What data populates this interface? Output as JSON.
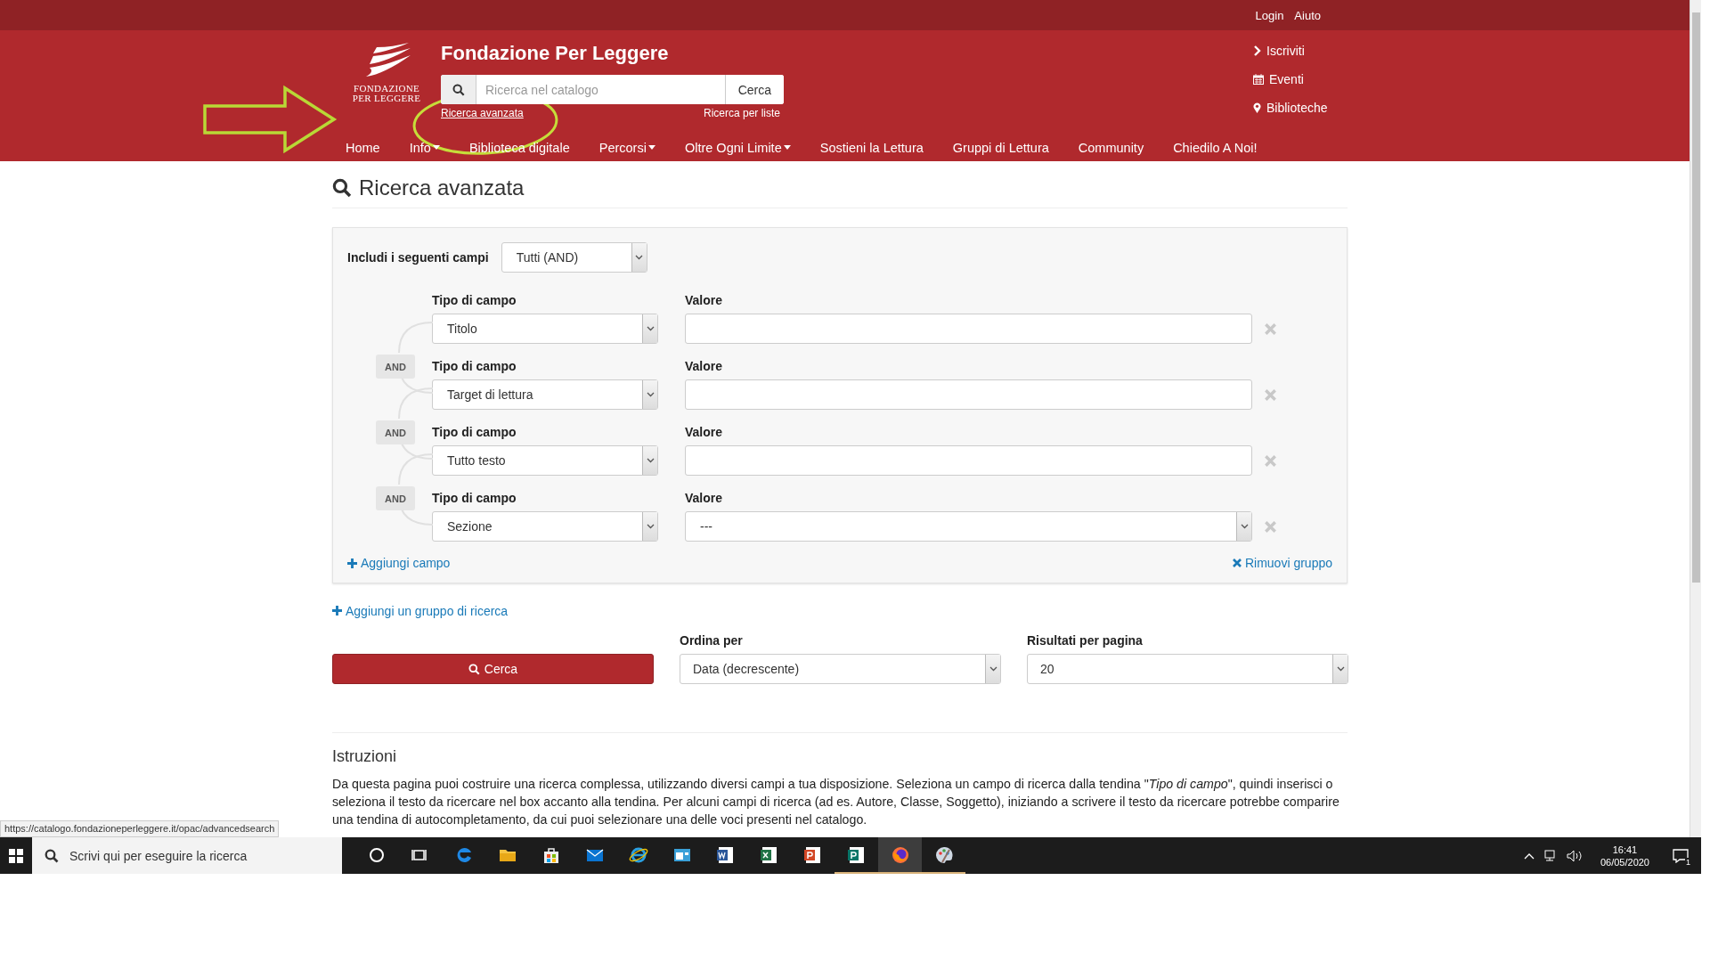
{
  "top_bar": {
    "links": [
      "Login",
      "Aiuto"
    ]
  },
  "header": {
    "logo_text": [
      "FONDAZIONE",
      "PER LEGGERE"
    ],
    "site_title": "Fondazione Per Leggere",
    "search": {
      "placeholder": "Ricerca nel catalogo",
      "button": "Cerca"
    },
    "search_links": [
      "Ricerca avanzata",
      "Ricerca per liste"
    ],
    "side_links": [
      {
        "label": "Iscriviti",
        "kind": "chevron"
      },
      {
        "label": "Eventi",
        "kind": "calendar"
      },
      {
        "label": "Biblioteche",
        "kind": "pin"
      }
    ],
    "nav": [
      {
        "label": "Home",
        "dropdown": false
      },
      {
        "label": "Info",
        "dropdown": true
      },
      {
        "label": "Biblioteca digitale",
        "dropdown": false
      },
      {
        "label": "Percorsi",
        "dropdown": true
      },
      {
        "label": "Oltre Ogni Limite",
        "dropdown": true
      },
      {
        "label": "Sostieni la Lettura",
        "dropdown": false
      },
      {
        "label": "Gruppi di Lettura",
        "dropdown": false
      },
      {
        "label": "Community",
        "dropdown": false
      },
      {
        "label": "Chiedilo A Noi!",
        "dropdown": false
      }
    ]
  },
  "page": {
    "title": "Ricerca avanzata",
    "group": {
      "include_label": "Includi i seguenti campi",
      "include_value": "Tutti (AND)",
      "rows": [
        {
          "field_label": "Tipo di campo",
          "field_value": "Titolo",
          "value_label": "Valore",
          "kind": "text"
        },
        {
          "connector": "AND",
          "field_label": "Tipo di campo",
          "field_value": "Target di lettura",
          "value_label": "Valore",
          "kind": "text"
        },
        {
          "connector": "AND",
          "field_label": "Tipo di campo",
          "field_value": "Tutto testo",
          "value_label": "Valore",
          "kind": "text"
        },
        {
          "connector": "AND",
          "field_label": "Tipo di campo",
          "field_value": "Sezione",
          "value_label": "Valore",
          "kind": "select",
          "value": "---"
        }
      ],
      "add_field": "Aggiungi campo",
      "remove_group": "Rimuovi gruppo"
    },
    "add_group": "Aggiungi un gruppo di ricerca",
    "search_button": "Cerca",
    "sort": {
      "label": "Ordina per",
      "value": "Data (decrescente)"
    },
    "per_page": {
      "label": "Risultati per pagina",
      "value": "20"
    },
    "instructions": {
      "title": "Istruzioni",
      "text": "Da questa pagina puoi costruire una ricerca complessa, utilizzando diversi campi a tua disposizione. Seleziona un campo di ricerca dalla tendina \"*Tipo di campo*\", quindi inserisci o seleziona il testo da ricercare nel box accanto alla tendina. Per alcuni campi di ricerca (ad es. Autore, Classe, Soggetto), iniziando a scrivere il testo da ricercare potrebbe comparire una tendina di autocompletamento, da cui puoi selezionare una delle voci presenti nel catalogo."
    }
  },
  "status_url": "https://catalogo.fondazioneperleggere.it/opac/advancedsearch",
  "taskbar": {
    "search_placeholder": "Scrivi qui per eseguire la ricerca",
    "apps": [
      {
        "kind": "cortana",
        "selected": false,
        "running": false
      },
      {
        "kind": "taskview",
        "selected": false,
        "running": false
      },
      {
        "kind": "edge",
        "selected": false,
        "running": false
      },
      {
        "kind": "folder",
        "selected": false,
        "running": false
      },
      {
        "kind": "store",
        "selected": false,
        "running": false
      },
      {
        "kind": "mail",
        "selected": false,
        "running": false
      },
      {
        "kind": "ie",
        "selected": false,
        "running": false
      },
      {
        "kind": "app",
        "selected": false,
        "running": false
      },
      {
        "kind": "word",
        "selected": false,
        "running": false
      },
      {
        "kind": "excel",
        "selected": false,
        "running": false
      },
      {
        "kind": "powerpoint",
        "selected": false,
        "running": false
      },
      {
        "kind": "publisher",
        "selected": false,
        "running": true
      },
      {
        "kind": "firefox",
        "selected": true,
        "running": true
      },
      {
        "kind": "paint",
        "selected": false,
        "running": true
      }
    ],
    "time": "16:41",
    "date": "06/05/2020",
    "notification_count": "1"
  }
}
